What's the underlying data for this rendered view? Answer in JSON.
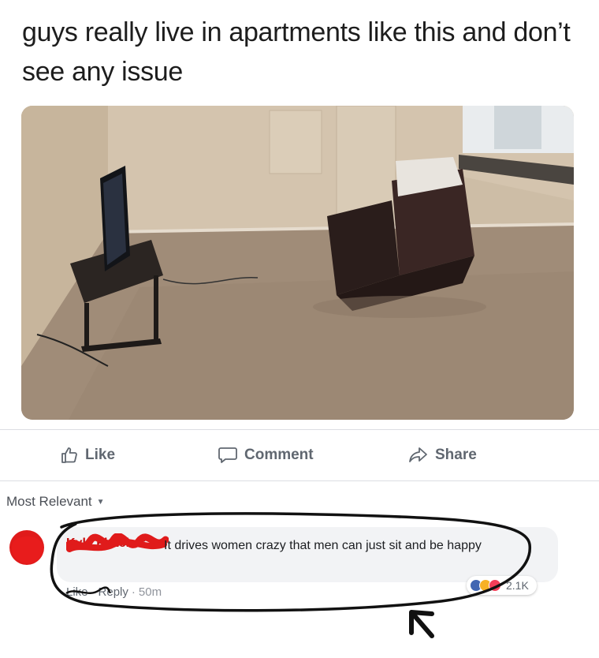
{
  "post": {
    "text": "guys really live in apartments like this and don’t see any issue"
  },
  "actions": {
    "like": "Like",
    "comment": "Comment",
    "share": "Share"
  },
  "comments_section": {
    "sort_label": "Most Relevant"
  },
  "comment": {
    "author": "Kyle Fletcher",
    "text": "It drives women crazy that men can just sit and be happy",
    "like_label": "Like",
    "reply_label": "Reply",
    "separator": "·",
    "time": "50m",
    "reaction_count": "2.1K",
    "reactions": [
      "like-icon",
      "haha-icon",
      "love-icon"
    ]
  },
  "colors": {
    "action_text": "#606770",
    "bubble_bg": "#f2f3f5",
    "like_blue": "#4267b2",
    "love_red": "#f33e58",
    "haha_yellow": "#f7b125",
    "censor_red": "#e01b1b",
    "ink_black": "#111111"
  }
}
